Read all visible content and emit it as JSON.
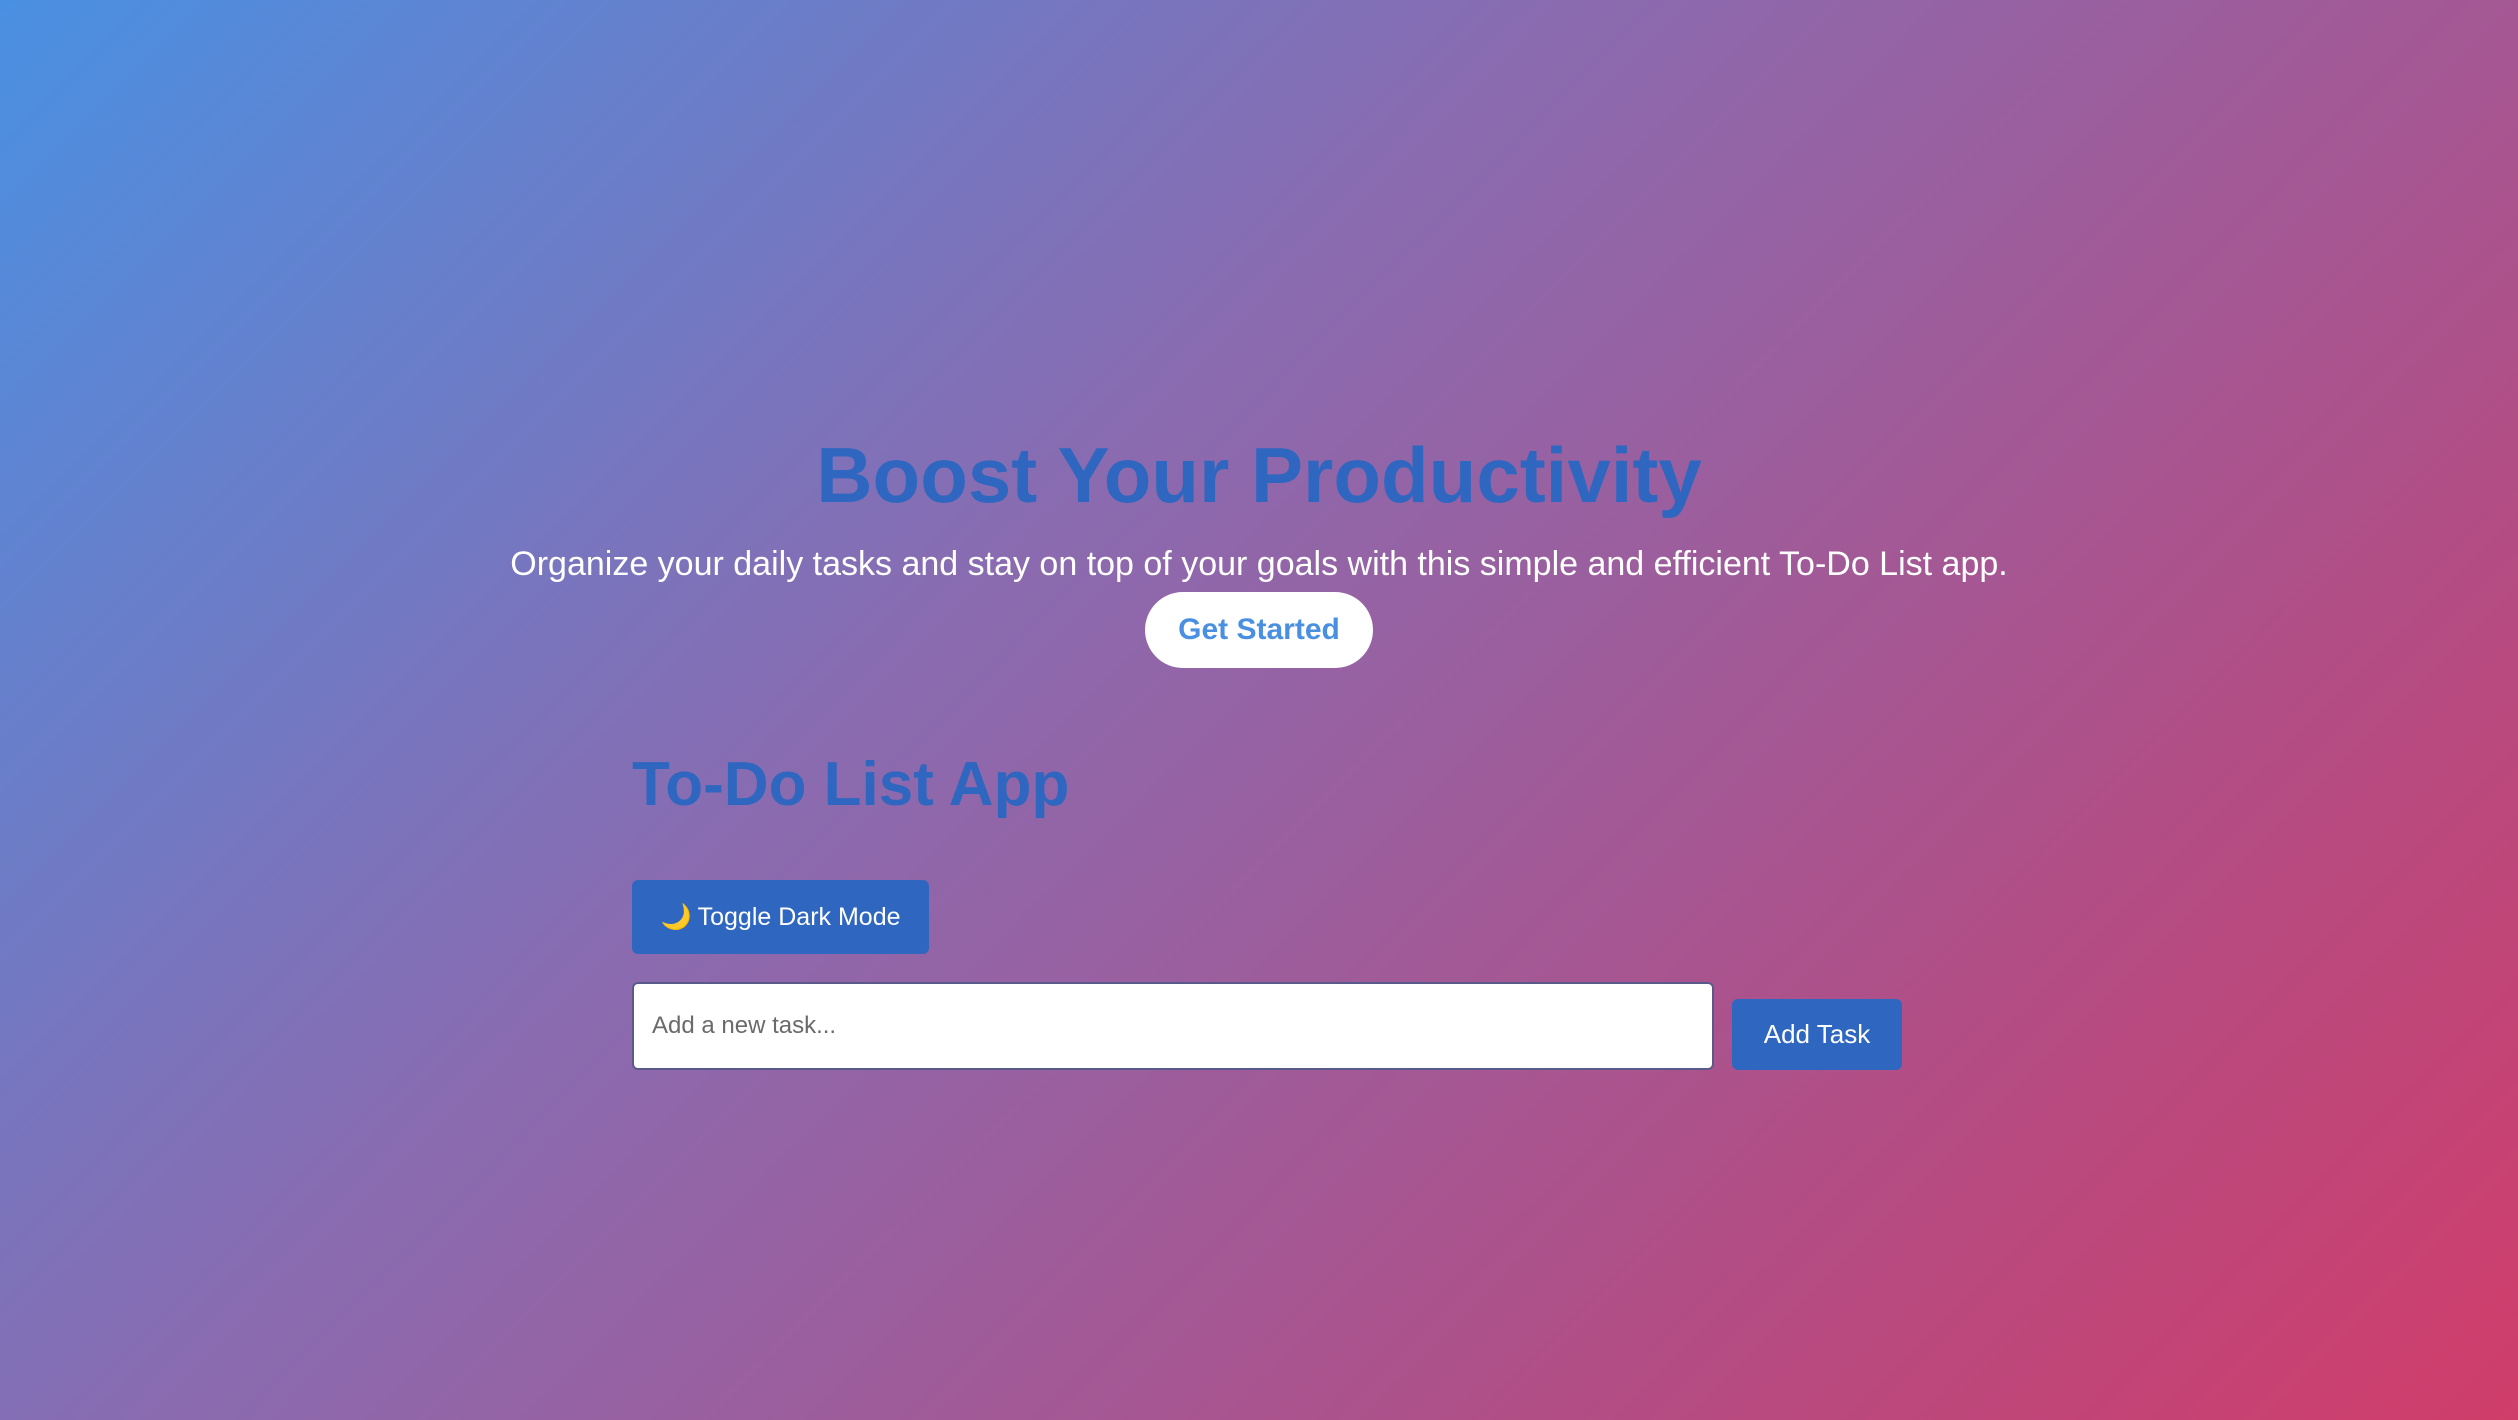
{
  "hero": {
    "title": "Boost Your Productivity",
    "subtitle": "Organize your daily tasks and stay on top of your goals with this simple and efficient To-Do List app.",
    "cta_label": "Get Started"
  },
  "app": {
    "title": "To-Do List App",
    "toggle_icon": "moon-icon",
    "toggle_icon_glyph": "🌙",
    "toggle_label": "Toggle Dark Mode",
    "task_input": {
      "placeholder": "Add a new task...",
      "value": ""
    },
    "add_label": "Add Task"
  },
  "colors": {
    "accent": "#2f67c0",
    "cta_text": "#4a90e2",
    "gradient_start": "#4a90e2",
    "gradient_end": "#d03d6a"
  }
}
